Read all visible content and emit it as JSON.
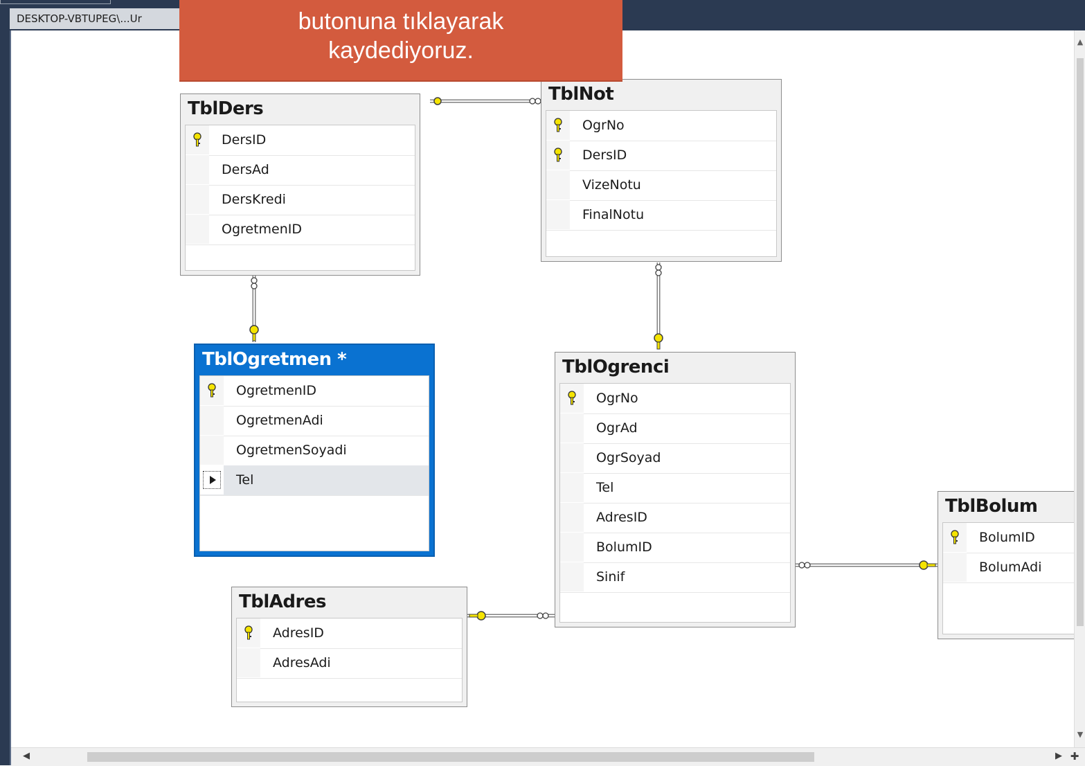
{
  "window": {
    "tab_label": "DESKTOP-VBTUPEG\\...Ur"
  },
  "callout": {
    "line1": "butonuna tıklayarak",
    "line2": "kaydediyoruz."
  },
  "tables": {
    "ders": {
      "name": "TblDers",
      "columns": [
        {
          "name": "DersID",
          "pk": true
        },
        {
          "name": "DersAd",
          "pk": false
        },
        {
          "name": "DersKredi",
          "pk": false
        },
        {
          "name": "OgretmenID",
          "pk": false
        }
      ]
    },
    "not": {
      "name": "TblNot",
      "columns": [
        {
          "name": "OgrNo",
          "pk": true
        },
        {
          "name": "DersID",
          "pk": true
        },
        {
          "name": "VizeNotu",
          "pk": false
        },
        {
          "name": "FinalNotu",
          "pk": false
        }
      ]
    },
    "ogretmen": {
      "name": "TblOgretmen *",
      "columns": [
        {
          "name": "OgretmenID",
          "pk": true
        },
        {
          "name": "OgretmenAdi",
          "pk": false
        },
        {
          "name": "OgretmenSoyadi",
          "pk": false
        },
        {
          "name": "Tel",
          "pk": false
        }
      ]
    },
    "ogrenci": {
      "name": "TblOgrenci",
      "columns": [
        {
          "name": "OgrNo",
          "pk": true
        },
        {
          "name": "OgrAd",
          "pk": false
        },
        {
          "name": "OgrSoyad",
          "pk": false
        },
        {
          "name": "Tel",
          "pk": false
        },
        {
          "name": "AdresID",
          "pk": false
        },
        {
          "name": "BolumID",
          "pk": false
        },
        {
          "name": "Sinif",
          "pk": false
        }
      ]
    },
    "bolum": {
      "name": "TblBolum",
      "columns": [
        {
          "name": "BolumID",
          "pk": true
        },
        {
          "name": "BolumAdi",
          "pk": false
        }
      ]
    },
    "adres": {
      "name": "TblAdres",
      "columns": [
        {
          "name": "AdresID",
          "pk": true
        },
        {
          "name": "AdresAdi",
          "pk": false
        }
      ]
    }
  },
  "colors": {
    "header_bar": "#2b3a52",
    "callout_bg": "#d35b3e",
    "selected_table": "#0a72d1",
    "key_yellow": "#f5e400"
  }
}
